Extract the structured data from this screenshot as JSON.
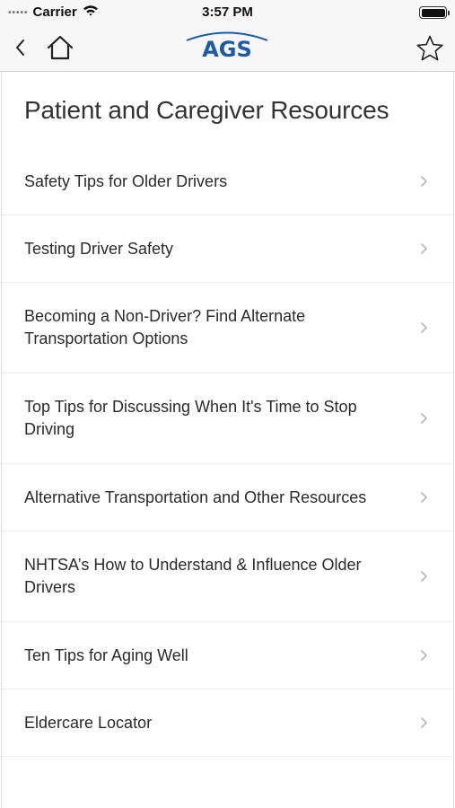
{
  "status_bar": {
    "signal": "•••••",
    "carrier": "Carrier",
    "time": "3:57 PM"
  },
  "nav": {
    "logo_text": "AGS",
    "brand_color": "#1a5aa8",
    "icons": [
      "back-icon",
      "home-icon",
      "star-icon"
    ]
  },
  "page": {
    "title": "Patient and Caregiver Resources"
  },
  "items": [
    {
      "label": "Safety Tips for Older Drivers"
    },
    {
      "label": "Testing Driver Safety"
    },
    {
      "label": "Becoming a Non-Driver? Find Alternate Transportation Options"
    },
    {
      "label": "Top Tips for Discussing When It's Time to Stop Driving"
    },
    {
      "label": "Alternative Transportation and Other Resources"
    },
    {
      "label": "NHTSA’s How to Understand & Influence Older Drivers"
    },
    {
      "label": "Ten Tips for Aging Well"
    },
    {
      "label": "Eldercare Locator"
    }
  ]
}
